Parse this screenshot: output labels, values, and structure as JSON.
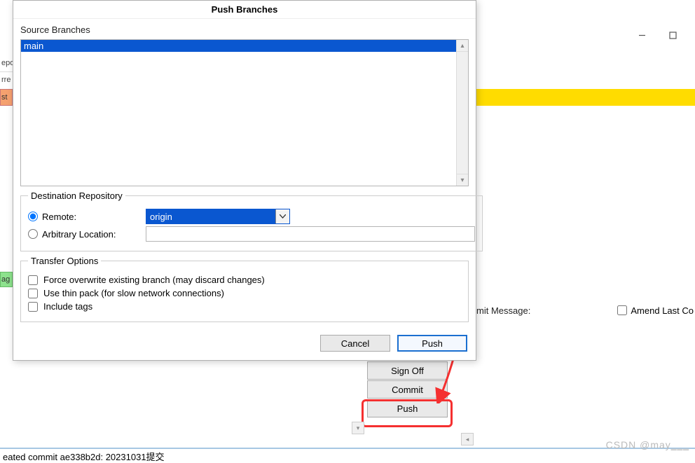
{
  "dialog": {
    "title": "Push Branches",
    "source_branches_label": "Source Branches",
    "source_branches": [
      "main"
    ],
    "destination_repository_label": "Destination Repository",
    "remote_label": "Remote:",
    "remote_selected": "origin",
    "remote_checked": true,
    "arbitrary_label": "Arbitrary Location:",
    "arbitrary_value": "",
    "arbitrary_checked": false,
    "transfer_options_label": "Transfer Options",
    "force_label": "Force overwrite existing branch (may discard changes)",
    "force_checked": false,
    "thin_label": "Use thin pack (for slow network connections)",
    "thin_checked": false,
    "tags_label": "Include tags",
    "tags_checked": false,
    "cancel_label": "Cancel",
    "push_label": "Push"
  },
  "background": {
    "toolbar_frag1": "epo",
    "toolbar_frag2": "rre",
    "tag_orange": "st",
    "tag_green": "ag",
    "commit_msg_label": "mit Message:",
    "amend_label": "Amend Last Co"
  },
  "side_buttons": {
    "sign_off": "Sign Off",
    "commit": "Commit",
    "push": "Push"
  },
  "status_bar": "eated commit ae338b2d: 20231031提交",
  "watermark": "CSDN @may‗‗‗"
}
